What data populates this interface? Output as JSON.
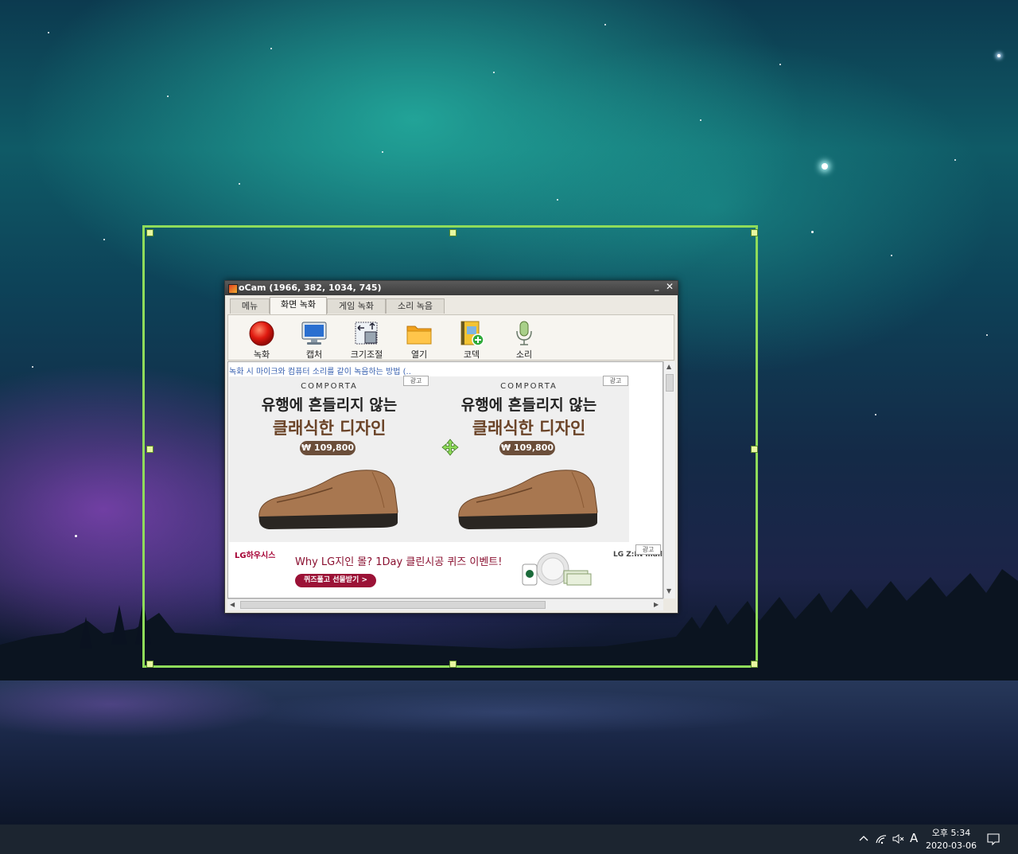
{
  "window": {
    "title": "oCam (1966, 382, 1034, 745)",
    "tabs": [
      {
        "label": "메뉴"
      },
      {
        "label": "화면 녹화"
      },
      {
        "label": "게임 녹화"
      },
      {
        "label": "소리 녹음"
      }
    ],
    "active_tab": "화면 녹화",
    "tools": [
      {
        "label": "녹화",
        "icon": "record-icon"
      },
      {
        "label": "캡처",
        "icon": "monitor-icon"
      },
      {
        "label": "크기조절",
        "icon": "resize-icon"
      },
      {
        "label": "열기",
        "icon": "folder-icon"
      },
      {
        "label": "코덱",
        "icon": "codec-icon"
      },
      {
        "label": "소리",
        "icon": "microphone-icon"
      }
    ],
    "notice_link": "녹화 시 마이크와 컴퓨터 소리를 같이 녹음하는 방법 (..",
    "ads": [
      {
        "tag": "광고",
        "brand": "COMPORTA",
        "headline": "유행에 흔들리지 않는",
        "subheadline": "클래식한 디자인",
        "price": "₩ 109,800"
      },
      {
        "tag": "광고",
        "brand": "COMPORTA",
        "headline": "유행에 흔들리지 않는",
        "subheadline": "클래식한 디자인",
        "price": "₩ 109,800"
      }
    ],
    "banner": {
      "logo": "LG하우시스",
      "text": "Why LG지인 몰? 1Day 클린시공 퀴즈 이벤트!",
      "button": "퀴즈풀고 선물받기 >",
      "right_logo": "LG Z:IN mall",
      "tag": "광고"
    }
  },
  "taskbar": {
    "ime": "A",
    "time": "오후 5:34",
    "date": "2020-03-06"
  },
  "colors": {
    "capture_border": "#8fdc5a",
    "taskbar": "#1c2530",
    "accent_brown": "#6b4428",
    "lg_red": "#9b1236"
  }
}
